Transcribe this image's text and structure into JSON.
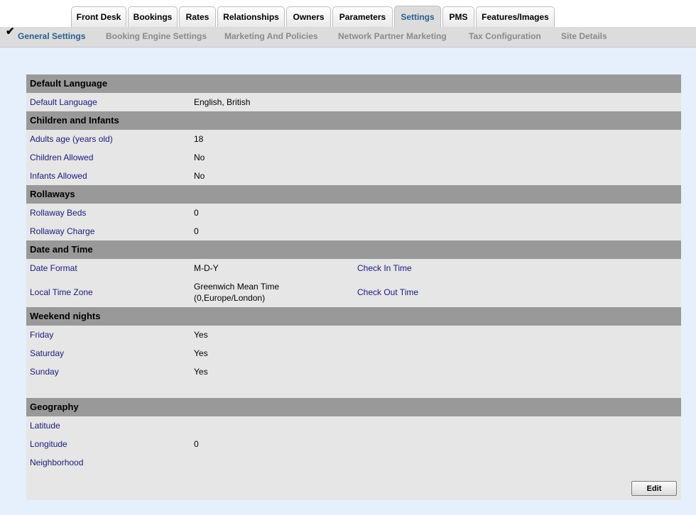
{
  "top_tabs": [
    "Front Desk",
    "Bookings",
    "Rates",
    "Relationships",
    "Owners",
    "Parameters",
    "Settings",
    "PMS",
    "Features/Images"
  ],
  "sub_tabs": [
    "General Settings",
    "Booking Engine Settings",
    "Marketing And Policies",
    "Network Partner Marketing",
    "Tax Configuration",
    "Site Details"
  ],
  "sections": {
    "language": {
      "title": "Default Language",
      "default_language_label": "Default Language",
      "default_language_value": "English, British"
    },
    "children": {
      "title": "Children and Infants",
      "adults_age_label": "Adults age (years old)",
      "adults_age_value": "18",
      "children_allowed_label": "Children Allowed",
      "children_allowed_value": "No",
      "infants_allowed_label": "Infants Allowed",
      "infants_allowed_value": "No"
    },
    "rollaways": {
      "title": "Rollaways",
      "beds_label": "Rollaway Beds",
      "beds_value": "0",
      "charge_label": "Rollaway Charge",
      "charge_value": "0"
    },
    "datetime": {
      "title": "Date and Time",
      "date_format_label": "Date Format",
      "date_format_value": "M-D-Y",
      "check_in_label": "Check In Time",
      "timezone_label": "Local Time Zone",
      "timezone_line1": "Greenwich Mean Time",
      "timezone_line2": "(0,Europe/London)",
      "check_out_label": "Check Out Time"
    },
    "weekend": {
      "title": "Weekend nights",
      "friday_label": "Friday",
      "friday_value": "Yes",
      "saturday_label": "Saturday",
      "saturday_value": "Yes",
      "sunday_label": "Sunday",
      "sunday_value": "Yes"
    },
    "geography": {
      "title": "Geography",
      "latitude_label": "Latitude",
      "longitude_label": "Longitude",
      "longitude_value": "0",
      "neighborhood_label": "Neighborhood"
    }
  },
  "edit_label": "Edit"
}
